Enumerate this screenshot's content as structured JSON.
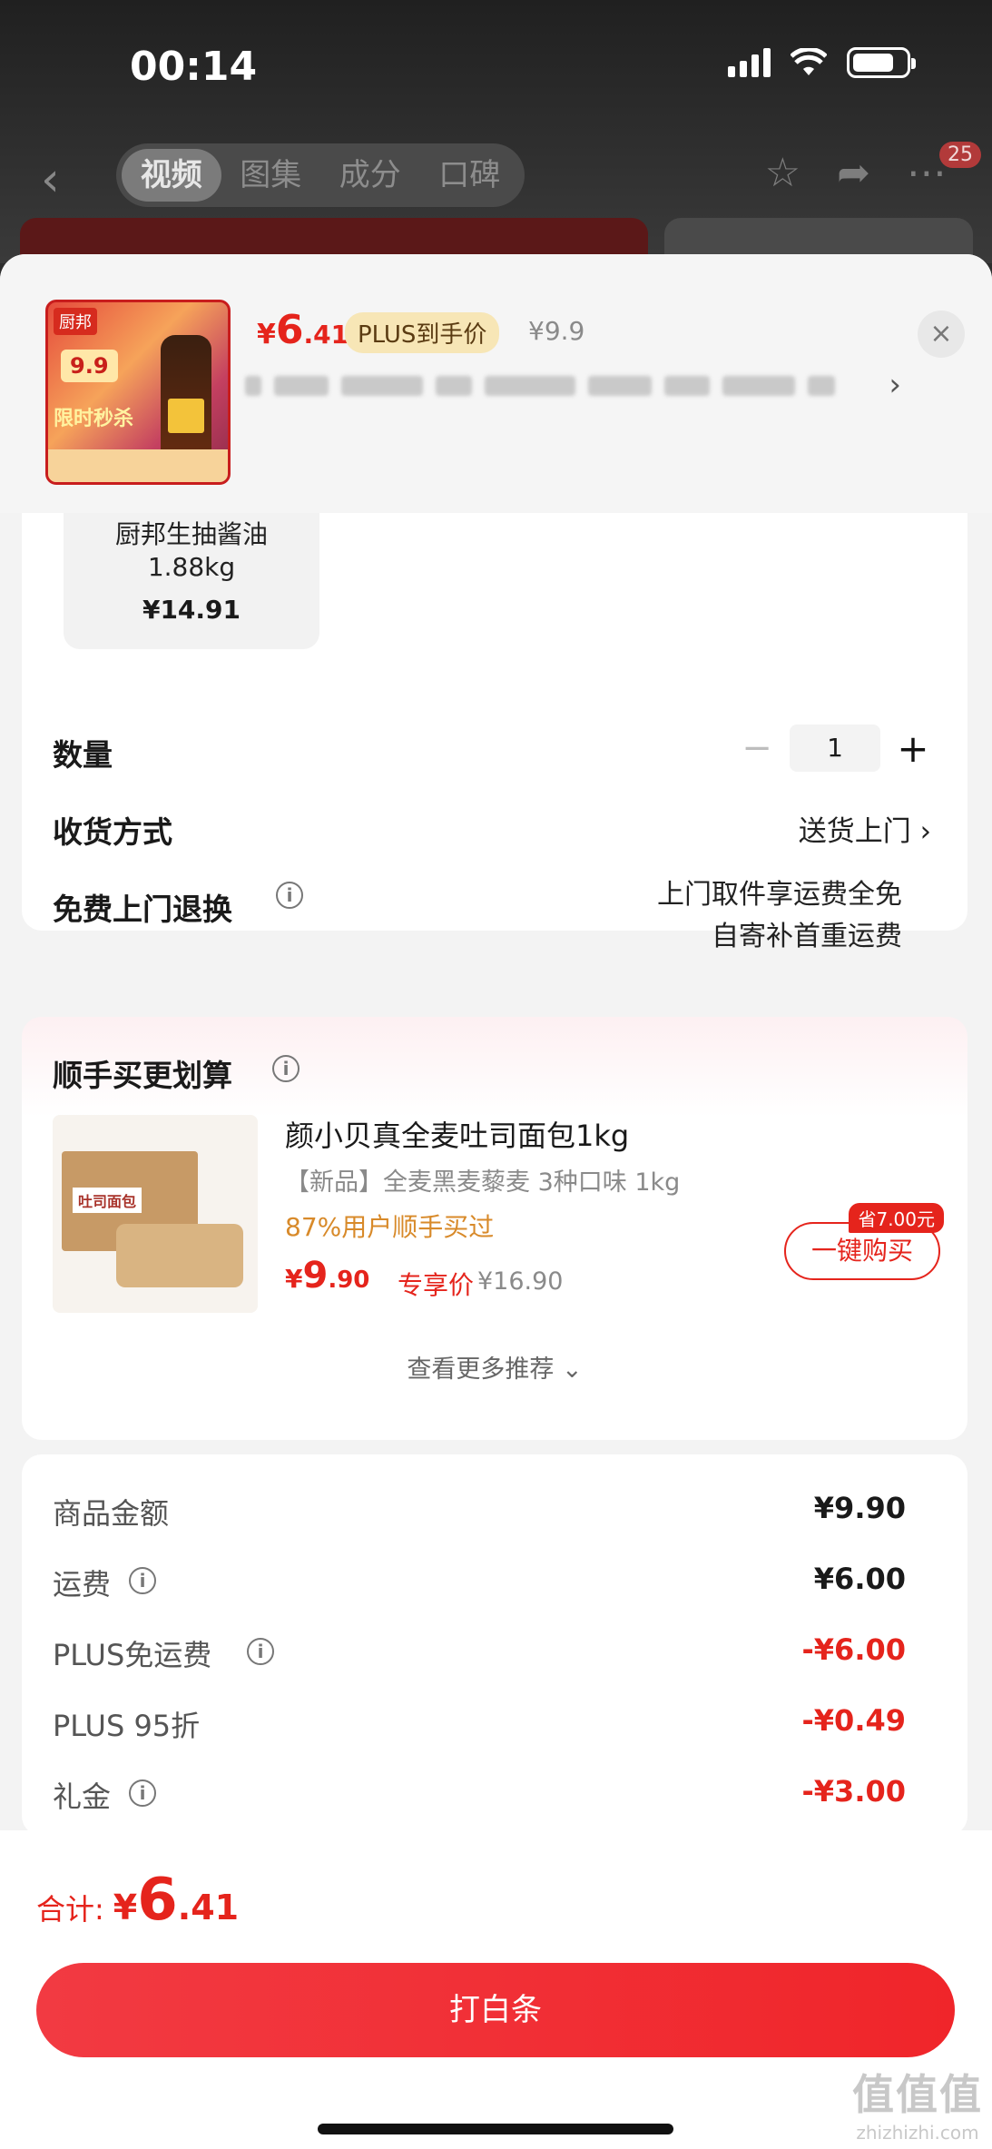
{
  "status_bar": {
    "time": "00:14"
  },
  "background_app": {
    "tabs": [
      "视频",
      "图集",
      "成分",
      "口碑"
    ],
    "active_tab": 0,
    "cart_count": "25"
  },
  "sheet_header": {
    "price_currency": "¥",
    "price_int": "6",
    "price_dec": ".41",
    "plus_tag": "PLUS到手价",
    "original_price": "¥9.9",
    "close": "×",
    "address_chevron": "›",
    "thumbnail": {
      "brand": "厨邦",
      "promo_price": "9.9",
      "promo_text": "限时秒杀"
    }
  },
  "spec": {
    "name": "厨邦生抽酱油1.88kg",
    "price": "¥14.91"
  },
  "order_options": {
    "quantity_label": "数量",
    "quantity_minus": "−",
    "quantity_value": "1",
    "quantity_plus": "+",
    "shipping_label": "收货方式",
    "shipping_value": "送货上门 ›",
    "return_label": "免费上门退换",
    "return_note_line1": "上门取件享运费全免",
    "return_note_line2": "自寄补首重运费"
  },
  "recommend": {
    "title": "顺手买更划算",
    "item_name": "颜小贝真全麦吐司面包1kg",
    "item_sub": "【新品】全麦黑麦藜麦 3种口味 1kg",
    "bought": "87%用户顺手买过",
    "price_currency": "¥",
    "price_int": "9",
    "price_dec": ".90",
    "exclusive": "专享价",
    "original_price": "¥16.90",
    "save_tag": "省7.00元",
    "buy_button": "一键购买",
    "more": "查看更多推荐 ⌄",
    "image_label": "吐司面包"
  },
  "amounts": [
    {
      "label": "商品金额",
      "info": false,
      "value": "¥9.90",
      "red": false
    },
    {
      "label": "运费",
      "info": true,
      "value": "¥6.00",
      "red": false
    },
    {
      "label": "PLUS免运费",
      "info": true,
      "value": "-¥6.00",
      "red": true
    },
    {
      "label": "PLUS 95折",
      "info": false,
      "value": "-¥0.49",
      "red": true
    },
    {
      "label": "礼金",
      "info": true,
      "value": "-¥3.00",
      "red": true
    }
  ],
  "bottom": {
    "total_label": "合计:",
    "total_currency": "¥",
    "total_int": "6",
    "total_dec": ".41",
    "pay_button": "打白条"
  },
  "watermark": {
    "mark": "值值值",
    "url": "zhizhizhi.com"
  }
}
